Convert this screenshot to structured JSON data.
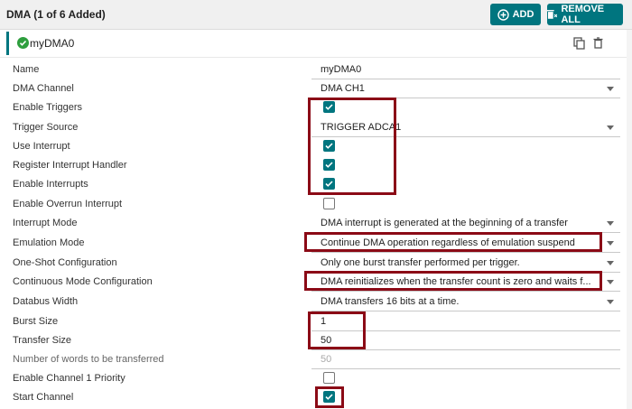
{
  "header": {
    "title": "DMA (1 of 6 Added)",
    "add_label": "ADD",
    "remove_all_label": "REMOVE ALL"
  },
  "instance": {
    "name": "myDMA0"
  },
  "fields": [
    {
      "label": "Name",
      "type": "text",
      "value": "myDMA0"
    },
    {
      "label": "DMA Channel",
      "type": "select",
      "value": "DMA CH1"
    },
    {
      "label": "Enable Triggers",
      "type": "checkbox",
      "checked": true
    },
    {
      "label": "Trigger Source",
      "type": "select",
      "value": "TRIGGER ADCA1"
    },
    {
      "label": "Use Interrupt",
      "type": "checkbox",
      "checked": true
    },
    {
      "label": "Register Interrupt Handler",
      "type": "checkbox",
      "checked": true
    },
    {
      "label": "Enable Interrupts",
      "type": "checkbox",
      "checked": true
    },
    {
      "label": "Enable Overrun Interrupt",
      "type": "checkbox",
      "checked": false
    },
    {
      "label": "Interrupt Mode",
      "type": "select",
      "value": "DMA interrupt is generated at the beginning of a transfer"
    },
    {
      "label": "Emulation Mode",
      "type": "select",
      "value": "Continue DMA operation regardless of emulation suspend"
    },
    {
      "label": "One-Shot Configuration",
      "type": "select",
      "value": "Only one burst transfer performed per trigger."
    },
    {
      "label": "Continuous Mode Configuration",
      "type": "select",
      "value": "DMA reinitializes when the transfer count is zero and waits f..."
    },
    {
      "label": "Databus Width",
      "type": "select",
      "value": "DMA transfers 16 bits at a time."
    },
    {
      "label": "Burst Size",
      "type": "text",
      "value": "1"
    },
    {
      "label": "Transfer Size",
      "type": "text",
      "value": "50"
    },
    {
      "label": "Number of words to be transferred",
      "type": "readonly",
      "value": "50"
    },
    {
      "label": "Enable Channel 1 Priority",
      "type": "checkbox",
      "checked": false
    },
    {
      "label": "Start Channel",
      "type": "checkbox",
      "checked": true
    }
  ],
  "colors": {
    "accent": "#00757f",
    "highlight": "#8b0a16"
  }
}
